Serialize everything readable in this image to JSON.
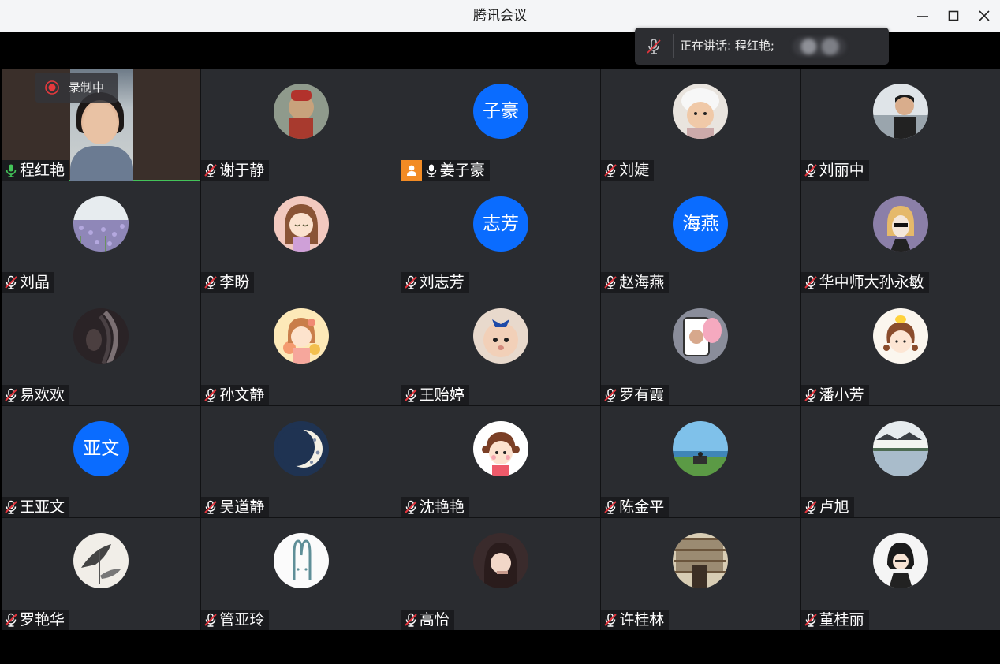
{
  "window": {
    "title": "腾讯会议",
    "minimize_icon": "minimize-icon",
    "maximize_icon": "maximize-icon",
    "close_icon": "close-icon"
  },
  "speaking": {
    "label": "正在讲话: 程红艳;",
    "icon": "mic-muted-icon"
  },
  "recording": {
    "label": "录制中",
    "icon": "record-icon"
  },
  "colors": {
    "accent_blue": "#0a6cff",
    "mic_active_green": "#43c459",
    "host_badge_orange": "#f28b24",
    "tile_bg": "#2a2c30"
  },
  "participants": [
    {
      "name": "程红艳",
      "mic": "active",
      "avatar": "video"
    },
    {
      "name": "谢于静",
      "mic": "muted",
      "avatar": "opera-figure-photo"
    },
    {
      "name": "姜子豪",
      "mic": "active",
      "host": true,
      "avatar": "text",
      "avatar_text": "子豪"
    },
    {
      "name": "刘婕",
      "mic": "muted",
      "avatar": "child-photo"
    },
    {
      "name": "刘丽中",
      "mic": "muted",
      "avatar": "man-photo"
    },
    {
      "name": "刘晶",
      "mic": "muted",
      "avatar": "flower-field-photo"
    },
    {
      "name": "李盼",
      "mic": "muted",
      "avatar": "cartoon-girl"
    },
    {
      "name": "刘志芳",
      "mic": "muted",
      "avatar": "text",
      "avatar_text": "志芳"
    },
    {
      "name": "赵海燕",
      "mic": "muted",
      "avatar": "text",
      "avatar_text": "海燕"
    },
    {
      "name": "华中师大孙永敏",
      "mic": "muted",
      "avatar": "cartoon-person"
    },
    {
      "name": "易欢欢",
      "mic": "muted",
      "avatar": "dark-portrait"
    },
    {
      "name": "孙文静",
      "mic": "muted",
      "avatar": "cartoon-girl-yellow"
    },
    {
      "name": "王贻婷",
      "mic": "muted",
      "avatar": "baby-photo"
    },
    {
      "name": "罗有霞",
      "mic": "muted",
      "avatar": "phone-sticker"
    },
    {
      "name": "潘小芳",
      "mic": "muted",
      "avatar": "cartoon-duck-girl"
    },
    {
      "name": "王亚文",
      "mic": "muted",
      "avatar": "text",
      "avatar_text": "亚文"
    },
    {
      "name": "吴道静",
      "mic": "muted",
      "avatar": "crescent-moon"
    },
    {
      "name": "沈艳艳",
      "mic": "muted",
      "avatar": "cartoon-girl-pink"
    },
    {
      "name": "陈金平",
      "mic": "muted",
      "avatar": "seaside-photo"
    },
    {
      "name": "卢旭",
      "mic": "muted",
      "avatar": "water-town-photo"
    },
    {
      "name": "罗艳华",
      "mic": "muted",
      "avatar": "ink-painting"
    },
    {
      "name": "管亚玲",
      "mic": "muted",
      "avatar": "bunny-drawing"
    },
    {
      "name": "高怡",
      "mic": "muted",
      "avatar": "girl-photo"
    },
    {
      "name": "许桂林",
      "mic": "muted",
      "avatar": "library-photo"
    },
    {
      "name": "董桂丽",
      "mic": "muted",
      "avatar": "anime-character"
    }
  ]
}
